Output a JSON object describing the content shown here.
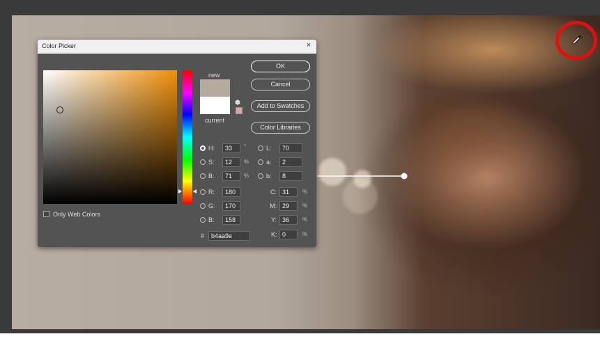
{
  "dialog": {
    "title": "Color Picker",
    "close": "×",
    "new_label": "new",
    "current_label": "current",
    "new_color": "#b4aa9e",
    "current_color": "#ffffff",
    "buttons": {
      "ok": "OK",
      "cancel": "Cancel",
      "add_swatches": "Add to Swatches",
      "color_libraries": "Color Libraries"
    },
    "only_web_colors": "Only Web Colors",
    "hsb": {
      "h": {
        "label": "H:",
        "value": "33",
        "unit": "°"
      },
      "s": {
        "label": "S:",
        "value": "12",
        "unit": "%"
      },
      "b": {
        "label": "B:",
        "value": "71",
        "unit": "%"
      }
    },
    "lab": {
      "l": {
        "label": "L:",
        "value": "70"
      },
      "a": {
        "label": "a:",
        "value": "2"
      },
      "b": {
        "label": "b:",
        "value": "8"
      }
    },
    "rgb": {
      "r": {
        "label": "R:",
        "value": "180"
      },
      "g": {
        "label": "G:",
        "value": "170"
      },
      "b": {
        "label": "B:",
        "value": "158"
      }
    },
    "cmyk": {
      "c": {
        "label": "C:",
        "value": "31",
        "unit": "%"
      },
      "m": {
        "label": "M:",
        "value": "29",
        "unit": "%"
      },
      "y": {
        "label": "Y:",
        "value": "36",
        "unit": "%"
      },
      "k": {
        "label": "K:",
        "value": "0",
        "unit": "%"
      }
    },
    "hex": {
      "label": "#",
      "value": "b4aa9e"
    }
  },
  "icons": {
    "eyedropper": "eyedropper-icon",
    "cube": "cube-icon"
  },
  "colors": {
    "highlight_circle": "#e01010",
    "dialog_bg": "#535353"
  }
}
